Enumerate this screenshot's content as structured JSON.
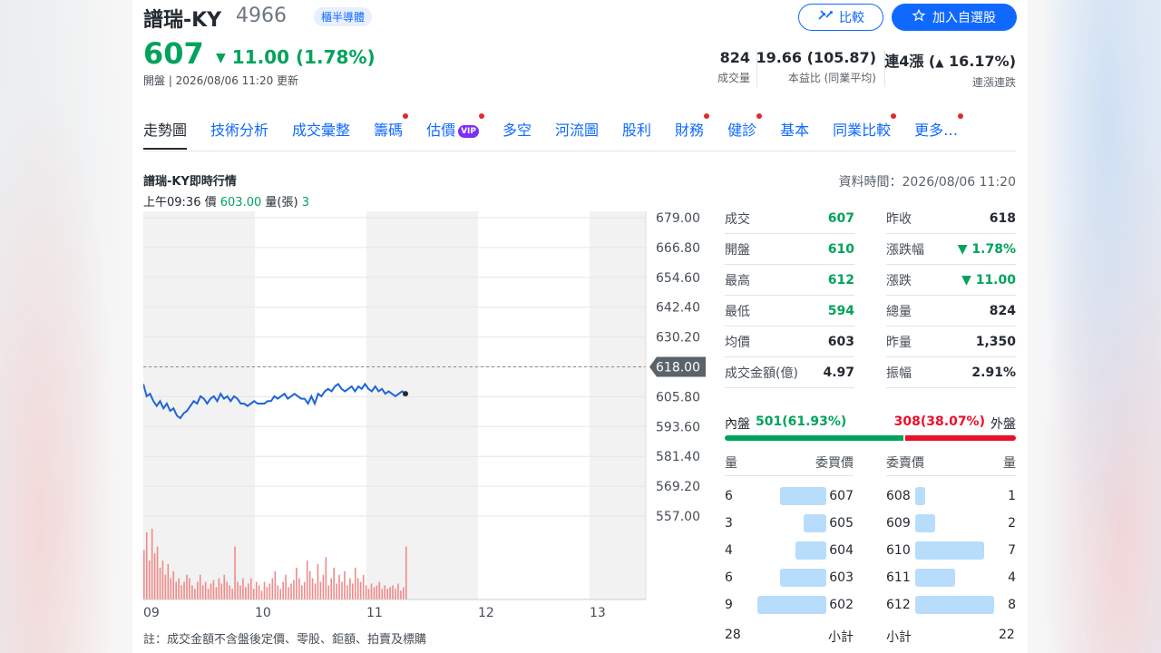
{
  "header": {
    "name": "譜瑞-KY",
    "ticker": "4966",
    "tag": "櫃半導體",
    "compare_label": "比較",
    "watchlist_label": "加入自選股"
  },
  "quote": {
    "price": "607",
    "change": "11.00 (1.78%)",
    "open_line": "開盤 | 2026/08/06 11:20 更新"
  },
  "stats": [
    {
      "value": "824",
      "label": "成交量"
    },
    {
      "value": "19.66 (105.87)",
      "label": "本益比 (同業平均)"
    },
    {
      "value": "連4漲 (",
      "value2": "16.17%)",
      "label": "連漲連跌"
    }
  ],
  "tabs": [
    {
      "label": "走勢圖",
      "active": true,
      "dot": false
    },
    {
      "label": "技術分析",
      "dot": false
    },
    {
      "label": "成交彙整",
      "dot": false
    },
    {
      "label": "籌碼",
      "dot": true
    },
    {
      "label": "估價",
      "dot": true,
      "vip": "VIP"
    },
    {
      "label": "多空",
      "dot": false
    },
    {
      "label": "河流圖",
      "dot": false
    },
    {
      "label": "股利",
      "dot": false
    },
    {
      "label": "財務",
      "dot": true
    },
    {
      "label": "健診",
      "dot": true
    },
    {
      "label": "基本",
      "dot": false
    },
    {
      "label": "同業比較",
      "dot": true
    },
    {
      "label": "更多…",
      "dot": true
    }
  ],
  "section": {
    "title": "譜瑞-KY即時行情",
    "data_time": "資料時間：2026/08/06 11:20",
    "tooltip_time": "上午09:36",
    "tooltip_price_label": "價",
    "tooltip_price": "603.00",
    "tooltip_vol_label": "量(張)",
    "tooltip_vol": "3"
  },
  "chart_data": {
    "type": "line",
    "x_ticks": [
      "09",
      "10",
      "11",
      "12",
      "13"
    ],
    "y_ticks": [
      "679.00",
      "666.80",
      "654.60",
      "642.40",
      "630.20",
      "618.00",
      "605.80",
      "593.60",
      "581.40",
      "569.20",
      "557.00"
    ],
    "ylim": [
      557.0,
      679.0
    ],
    "reference_price": "618.00",
    "price_series": [
      611,
      606,
      607,
      604,
      602,
      604,
      601,
      603,
      600,
      601,
      598,
      597,
      599,
      600,
      602,
      604,
      603,
      606,
      605,
      603,
      605,
      606,
      604,
      607,
      605,
      606,
      604,
      606,
      605,
      603,
      603,
      602,
      603,
      604,
      603,
      603,
      603,
      604,
      604,
      606,
      605,
      606,
      607,
      605,
      606,
      607,
      606,
      605,
      605,
      603,
      606,
      603,
      607,
      606,
      608,
      609,
      608,
      610,
      611,
      609,
      608,
      609,
      610,
      608,
      610,
      609,
      611,
      609,
      608,
      610,
      608,
      609,
      607,
      608,
      607,
      606,
      607,
      608,
      607
    ],
    "volume_series": [
      28,
      38,
      22,
      40,
      26,
      30,
      18,
      22,
      14,
      20,
      12,
      16,
      10,
      12,
      8,
      10,
      14,
      12,
      8,
      6,
      10,
      14,
      8,
      10,
      6,
      9,
      11,
      7,
      12,
      9,
      14,
      10,
      8,
      6,
      30,
      10,
      8,
      12,
      7,
      9,
      12,
      6,
      10,
      8,
      5,
      10,
      7,
      9,
      12,
      16,
      8,
      6,
      10,
      14,
      7,
      9,
      11,
      18,
      12,
      8,
      10,
      22,
      16,
      12,
      9,
      20,
      10,
      14,
      24,
      8,
      12,
      18,
      9,
      14,
      10,
      16,
      8,
      12,
      9,
      18,
      12,
      10,
      14,
      8,
      6,
      9,
      7,
      8,
      10,
      6,
      8,
      6,
      7,
      8,
      6,
      9,
      5,
      7,
      30
    ],
    "volume_max": 40
  },
  "quote_table": [
    {
      "k1": "成交",
      "v1": "607",
      "c1": "green",
      "k2": "昨收",
      "v2": "618",
      "c2": "dark"
    },
    {
      "k1": "開盤",
      "v1": "610",
      "c1": "green",
      "k2": "漲跌幅",
      "v2": "▼ 1.78%",
      "c2": "green"
    },
    {
      "k1": "最高",
      "v1": "612",
      "c1": "green",
      "k2": "漲跌",
      "v2": "▼ 11.00",
      "c2": "green"
    },
    {
      "k1": "最低",
      "v1": "594",
      "c1": "green",
      "k2": "總量",
      "v2": "824",
      "c2": "dark"
    },
    {
      "k1": "均價",
      "v1": "603",
      "c1": "dark",
      "k2": "昨量",
      "v2": "1,350",
      "c2": "dark"
    },
    {
      "k1": "成交金額(億)",
      "v1": "4.97",
      "c1": "dark",
      "k2": "振幅",
      "v2": "2.91%",
      "c2": "dark"
    }
  ],
  "inout": {
    "in_label": "內盤",
    "in_value": "501(61.93%)",
    "out_value": "308(38.07%)",
    "out_label": "外盤",
    "in_ratio": 0.6193
  },
  "orderbook": {
    "bid_head_qty": "量",
    "bid_head_price": "委買價",
    "ask_head_price": "委賣價",
    "ask_head_qty": "量",
    "bids": [
      {
        "qty": "6",
        "price": "607",
        "q": 6
      },
      {
        "qty": "3",
        "price": "605",
        "q": 3
      },
      {
        "qty": "4",
        "price": "604",
        "q": 4
      },
      {
        "qty": "6",
        "price": "603",
        "q": 6
      },
      {
        "qty": "9",
        "price": "602",
        "q": 9
      }
    ],
    "asks": [
      {
        "price": "608",
        "qty": "1",
        "q": 1
      },
      {
        "price": "609",
        "qty": "2",
        "q": 2
      },
      {
        "price": "610",
        "qty": "7",
        "q": 7
      },
      {
        "price": "611",
        "qty": "4",
        "q": 4
      },
      {
        "price": "612",
        "qty": "8",
        "q": 8
      }
    ],
    "bid_total": "28",
    "bid_total_label": "小計",
    "ask_total_label": "小計",
    "ask_total": "22"
  },
  "footnote": "註：成交金額不含盤後定價、零股、鉅額、拍賣及標購",
  "colors": {
    "up": "#eb0f29",
    "down": "#00a35c",
    "accent": "#0f69ff",
    "line": "#1d65d8"
  }
}
